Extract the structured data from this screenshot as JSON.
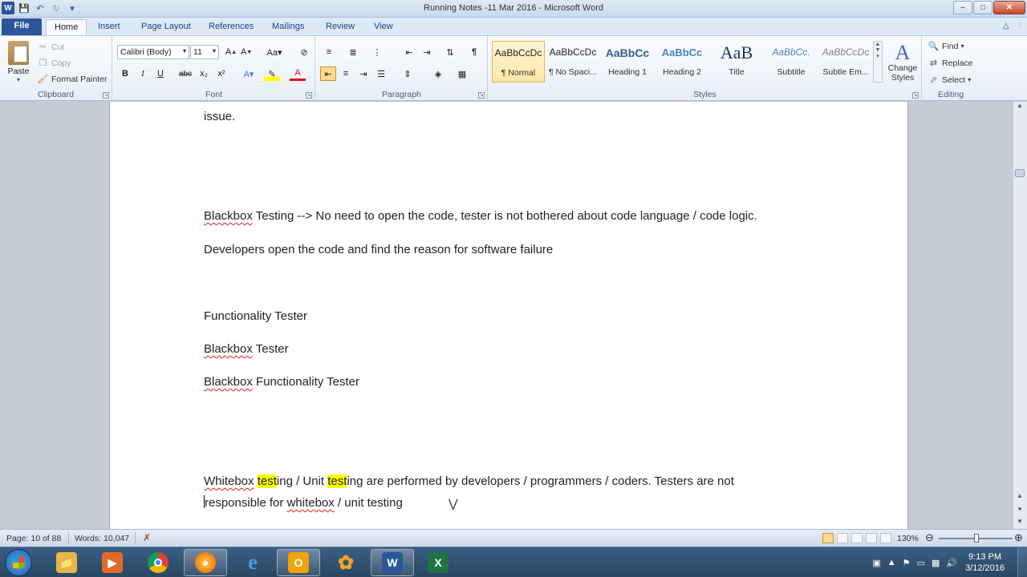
{
  "window": {
    "title": "Running Notes -11 Mar 2016  -  Microsoft Word",
    "qat_icons": [
      "word-logo-icon",
      "save-icon",
      "undo-icon",
      "redo-icon",
      "customize-qat-icon"
    ],
    "controls": {
      "minimize": "–",
      "maximize": "□",
      "close": "✕"
    }
  },
  "tabs": {
    "file": "File",
    "items": [
      "Home",
      "Insert",
      "Page Layout",
      "References",
      "Mailings",
      "Review",
      "View"
    ],
    "active": "Home"
  },
  "ribbon": {
    "clipboard": {
      "label": "Clipboard",
      "paste": "Paste",
      "cut": "Cut",
      "copy": "Copy",
      "format_painter": "Format Painter"
    },
    "font": {
      "label": "Font",
      "font_name": "Calibri (Body)",
      "font_size": "11",
      "buttons": [
        "B",
        "I",
        "U",
        "abc",
        "x₂",
        "x²"
      ]
    },
    "paragraph": {
      "label": "Paragraph"
    },
    "styles": {
      "label": "Styles",
      "items": [
        {
          "sample": "AaBbCcDc",
          "name": "¶ Normal",
          "selected": true
        },
        {
          "sample": "AaBbCcDc",
          "name": "¶ No Spaci...",
          "selected": false
        },
        {
          "sample": "AaBbCc",
          "name": "Heading 1",
          "selected": false
        },
        {
          "sample": "AaBbCc",
          "name": "Heading 2",
          "selected": false
        },
        {
          "sample": "AaB",
          "name": "Title",
          "selected": false
        },
        {
          "sample": "AaBbCc.",
          "name": "Subtitle",
          "selected": false
        },
        {
          "sample": "AaBbCcDc",
          "name": "Subtle Em...",
          "selected": false
        }
      ],
      "change_styles": "Change Styles"
    },
    "editing": {
      "label": "Editing",
      "find": "Find",
      "replace": "Replace",
      "select": "Select"
    }
  },
  "document": {
    "line1": "issue.",
    "line2_a": "Blackbox",
    "line2_b": " Testing  --> No need to open the code, tester is not bothered about code language / code logic.",
    "line3": "Developers open the code and find the reason for software failure",
    "line4": "Functionality Tester",
    "line5_a": "Blackbox",
    "line5_b": " Tester",
    "line6_a": "Blackbox",
    "line6_b": " Functionality Tester",
    "line7_a": "Whitebox",
    "line7_b": " ",
    "line7_c": "test",
    "line7_d": "ing / Unit ",
    "line7_e": "test",
    "line7_f": "ing are performed by developers / programmers / coders. Testers are not",
    "line8_a": "responsible for ",
    "line8_b": "whitebox",
    "line8_c": " / unit testing"
  },
  "statusbar": {
    "page": "Page: 10 of 88",
    "words": "Words: 10,047",
    "zoom": "130%",
    "zoom_level_percent": 130
  },
  "taskbar": {
    "apps": [
      "explorer",
      "media-player",
      "chrome",
      "firefox",
      "internet-explorer",
      "outlook",
      "app-flower",
      "word",
      "excel"
    ],
    "time": "9:13 PM",
    "date": "3/12/2016"
  }
}
